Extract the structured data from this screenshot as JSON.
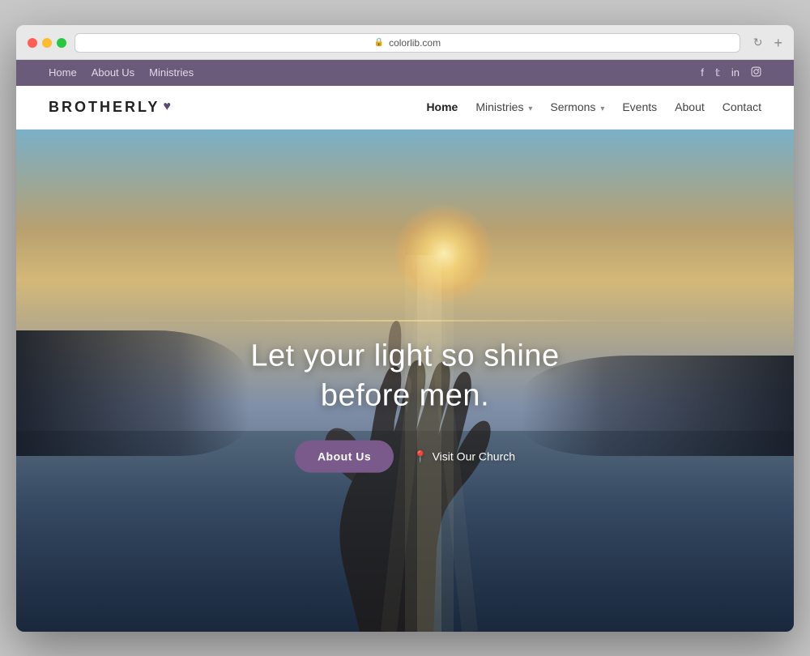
{
  "browser": {
    "url": "colorlib.com",
    "new_tab_icon": "+"
  },
  "top_bar": {
    "nav_items": [
      {
        "label": "Home",
        "href": "#"
      },
      {
        "label": "About Us",
        "href": "#"
      },
      {
        "label": "Ministries",
        "href": "#"
      }
    ],
    "social_links": [
      {
        "label": "f",
        "href": "#",
        "name": "facebook"
      },
      {
        "label": "t",
        "href": "#",
        "name": "twitter"
      },
      {
        "label": "in",
        "href": "#",
        "name": "linkedin"
      },
      {
        "label": "◻",
        "href": "#",
        "name": "instagram"
      }
    ]
  },
  "main_nav": {
    "brand": "BROTHERLY",
    "brand_heart": "♥",
    "links": [
      {
        "label": "Home",
        "active": true,
        "has_dropdown": false
      },
      {
        "label": "Ministries",
        "active": false,
        "has_dropdown": true
      },
      {
        "label": "Sermons",
        "active": false,
        "has_dropdown": true
      },
      {
        "label": "Events",
        "active": false,
        "has_dropdown": false
      },
      {
        "label": "About",
        "active": false,
        "has_dropdown": false
      },
      {
        "label": "Contact",
        "active": false,
        "has_dropdown": false
      }
    ]
  },
  "hero": {
    "quote_line1": "Let your light so shine",
    "quote_line2": "before men.",
    "btn_about_us": "About Us",
    "btn_visit": "Visit Our Church",
    "location_pin": "📍"
  }
}
